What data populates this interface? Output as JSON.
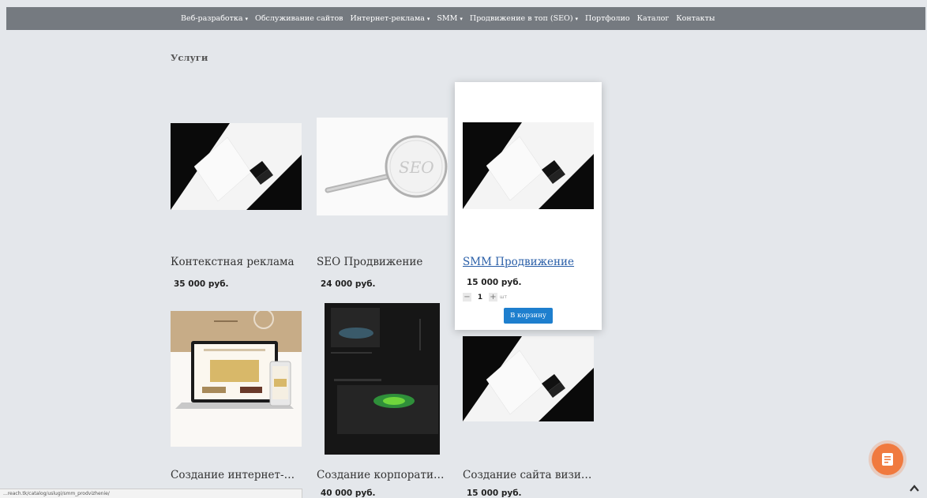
{
  "nav": {
    "items": [
      {
        "label": "Веб-разработка",
        "dropdown": true
      },
      {
        "label": "Обслуживание сайтов",
        "dropdown": false
      },
      {
        "label": "Интернет-реклама",
        "dropdown": true
      },
      {
        "label": "SMM",
        "dropdown": true
      },
      {
        "label": "Продвижение в топ (SEO)",
        "dropdown": true
      },
      {
        "label": "Портфолио",
        "dropdown": false
      },
      {
        "label": "Каталог",
        "dropdown": false
      },
      {
        "label": "Контакты",
        "dropdown": false
      }
    ],
    "caret": "▾"
  },
  "page": {
    "title": "Услуги"
  },
  "products": [
    {
      "name": "Контекстная реклама",
      "price": "35 000 руб."
    },
    {
      "name": "SEO Продвижение",
      "price": "24 000 руб."
    },
    {
      "name": "SMM Продвижение",
      "price": "15 000 руб.",
      "qty": "1",
      "unit": "шт",
      "minus": "−",
      "plus": "+",
      "cart_label": "В корзину"
    },
    {
      "name": "Создание интернет-магазина",
      "price": ""
    },
    {
      "name": "Создание корпоративного сайта",
      "price": "40 000 руб."
    },
    {
      "name": "Создание сайта визитки",
      "price": "15 000 руб."
    }
  ],
  "status_url": "...reach.tk/catalog/uslugi/smm_prodvizhenie/",
  "colors": {
    "topbar": "#757a80",
    "accent": "#1e7fce",
    "fab": "#f07a3f",
    "link": "#2a5fa8"
  },
  "icons": {
    "fab": "chat-note-icon",
    "scroll": "chevron-up-icon"
  }
}
